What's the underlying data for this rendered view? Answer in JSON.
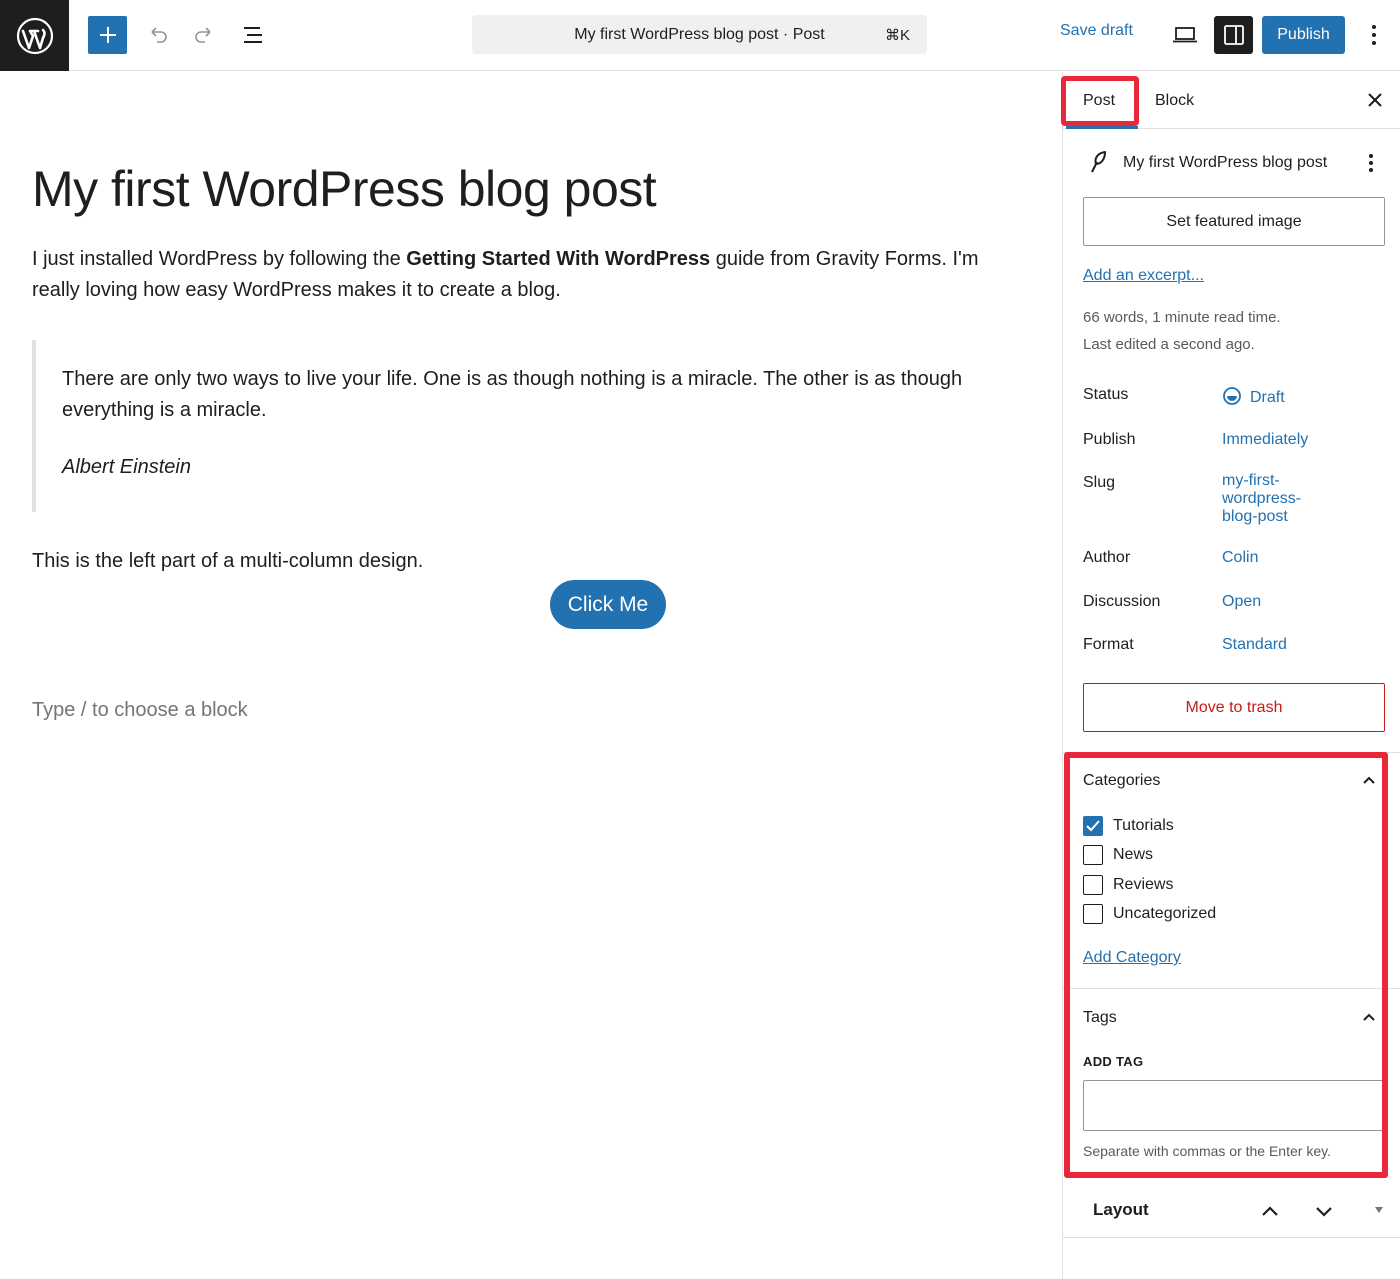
{
  "toolbar": {
    "command_bar": "My first WordPress blog post · Post",
    "shortcut": "⌘K",
    "save_draft": "Save draft",
    "publish": "Publish"
  },
  "editor": {
    "title": "My first WordPress blog post",
    "paragraph1_before": "I just installed WordPress by following the ",
    "paragraph1_bold": "Getting Started With WordPress",
    "paragraph1_after": " guide from Gravity Forms. I'm really loving how easy WordPress makes it to create a blog.",
    "quote_text": "There are only two ways to live your life. One is as though nothing is a miracle. The other is as though everything is a miracle.",
    "quote_cite": "Albert Einstein",
    "paragraph2": "This is the left part of a multi-column design.",
    "button_label": "Click Me",
    "block_placeholder": "Type / to choose a block"
  },
  "sidebar": {
    "tabs": {
      "post": "Post",
      "block": "Block"
    },
    "post_title": "My first WordPress blog post",
    "featured_image": "Set featured image",
    "excerpt_link": "Add an excerpt...",
    "meta_words": "66 words, 1 minute read time.",
    "meta_edited": "Last edited a second ago.",
    "rows": {
      "status_label": "Status",
      "status_value": "Draft",
      "publish_label": "Publish",
      "publish_value": "Immediately",
      "slug_label": "Slug",
      "slug_line1": "my-first-",
      "slug_line2": "wordpress-",
      "slug_line3": "blog-post",
      "author_label": "Author",
      "author_value": "Colin",
      "discussion_label": "Discussion",
      "discussion_value": "Open",
      "format_label": "Format",
      "format_value": "Standard"
    },
    "trash": "Move to trash",
    "categories": {
      "title": "Categories",
      "items": [
        {
          "label": "Tutorials",
          "checked": true
        },
        {
          "label": "News",
          "checked": false
        },
        {
          "label": "Reviews",
          "checked": false
        },
        {
          "label": "Uncategorized",
          "checked": false
        }
      ],
      "add": "Add Category"
    },
    "tags": {
      "title": "Tags",
      "add_label": "ADD TAG",
      "input_value": "",
      "help": "Separate with commas or the Enter key."
    },
    "layout": {
      "title": "Layout"
    }
  },
  "colors": {
    "accent": "#2271b1",
    "danger": "#cc1818",
    "highlight": "#e8283a",
    "dark": "#1e1e1e"
  },
  "icons": [
    "wordpress-logo-icon",
    "plus-icon",
    "undo-icon",
    "redo-icon",
    "list-view-icon",
    "desktop-view-icon",
    "sidebar-toggle-icon",
    "more-vertical-icon",
    "close-icon",
    "feather-icon",
    "draft-status-icon",
    "check-icon",
    "chevron-up-icon",
    "chevron-down-icon",
    "caret-down-icon"
  ]
}
